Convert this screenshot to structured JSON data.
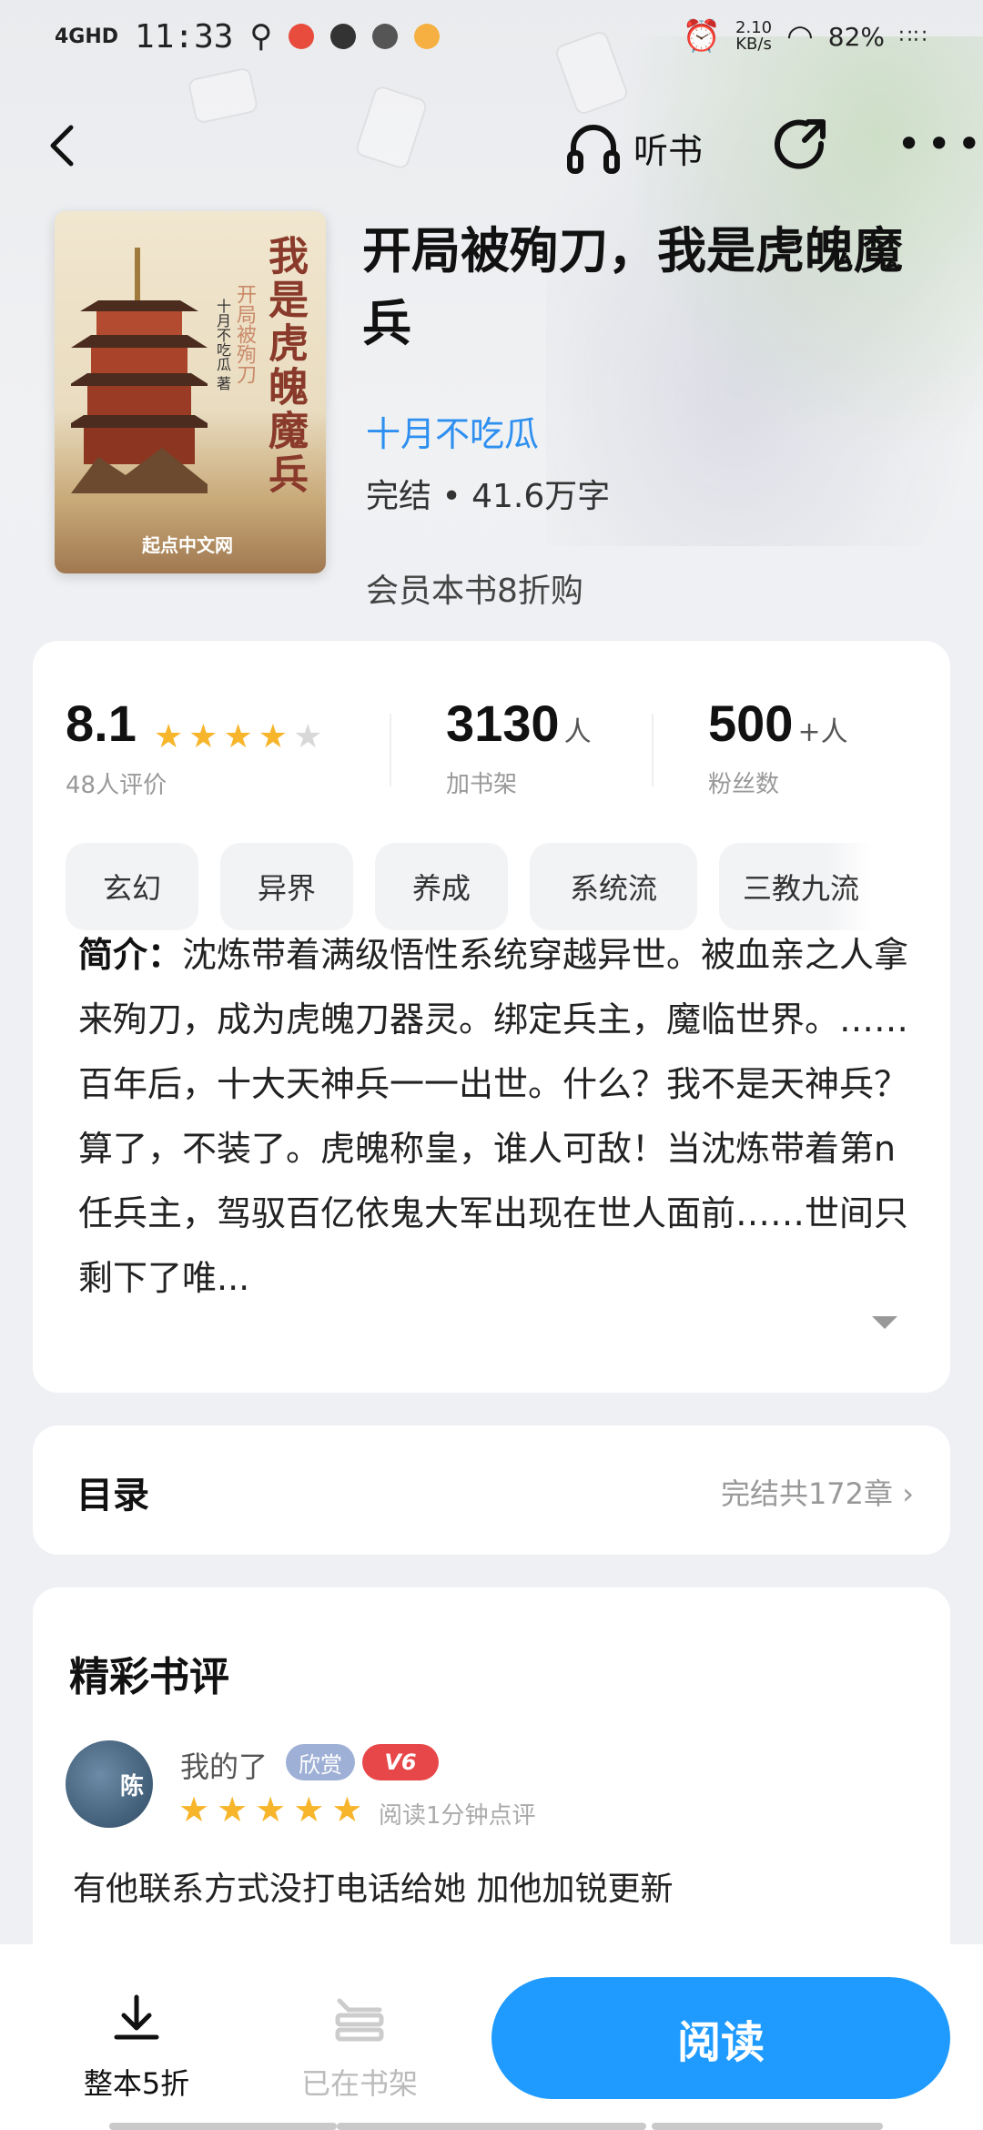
{
  "status": {
    "network": "4GHD",
    "time": "11:33",
    "speed": "2.10",
    "speed_unit": "KB/s",
    "battery": "82%"
  },
  "header": {
    "back_icon": "back-arrow-icon",
    "listen_label": "听书",
    "share_icon": "share-icon",
    "more_icon": "more-icon"
  },
  "book": {
    "title": "开局被殉刀，我是虎魄魔兵",
    "author": "十月不吃瓜",
    "meta": "完结 • 41.6万字",
    "vip_offer": "会员本书8折购",
    "cover": {
      "title": "我是虎魄魔兵",
      "subtitle": "开局被殉刀",
      "author": "十月不吃瓜 著",
      "publisher": "起点中文网"
    }
  },
  "stats": {
    "rating": "8.1",
    "rating_label": "48人评价",
    "rating_stars": 4,
    "bookshelf_count": "3130",
    "bookshelf_unit": "人",
    "bookshelf_label": "加书架",
    "fans_count": "500",
    "fans_unit": "+人",
    "fans_label": "粉丝数"
  },
  "tags": [
    "玄幻",
    "异界",
    "养成",
    "系统流",
    "三教九流"
  ],
  "intro": {
    "label": "简介：",
    "text": "沈炼带着满级悟性系统穿越异世。被血亲之人拿来殉刀，成为虎魄刀器灵。绑定兵主，魔临世界。……百年后，十大天神兵一一出世。什么？我不是天神兵？算了，不装了。虎魄称皇，谁人可敌！当沈炼带着第n任兵主，驾驭百亿依鬼大军出现在世人面前……世间只剩下了唯..."
  },
  "toc": {
    "title": "目录",
    "summary": "完结共172章"
  },
  "reviews": {
    "title": "精彩书评",
    "items": [
      {
        "user": "我的了",
        "avatar_text": "陈",
        "badge": "欣赏",
        "level": "V6",
        "stars": 5,
        "read_time": "阅读1分钟点评",
        "text": "有他联系方式没打电话给她 加他加锐更新"
      }
    ]
  },
  "bottom": {
    "download_label": "整本5折",
    "shelf_label": "已在书架",
    "read_label": "阅读"
  },
  "colors": {
    "accent": "#1f9bff",
    "author_link": "#2d8ff0",
    "star": "#f7b52c"
  }
}
